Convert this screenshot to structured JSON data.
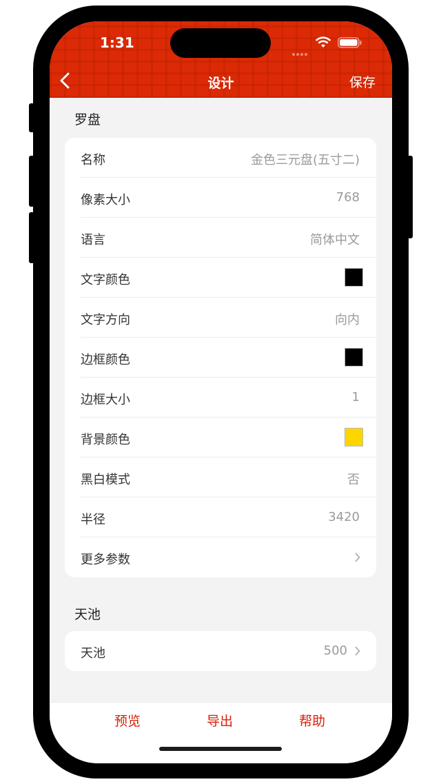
{
  "status": {
    "time": "1:31"
  },
  "nav": {
    "back_label": "<",
    "title": "设计",
    "save_label": "保存"
  },
  "sections": {
    "compass": {
      "title": "罗盘",
      "rows": [
        {
          "label": "名称",
          "value": "金色三元盘(五寸二)"
        },
        {
          "label": "像素大小",
          "value": "768"
        },
        {
          "label": "语言",
          "value": "简体中文"
        },
        {
          "label": "文字颜色",
          "color": "#000000"
        },
        {
          "label": "文字方向",
          "value": "向内"
        },
        {
          "label": "边框颜色",
          "color": "#000000"
        },
        {
          "label": "边框大小",
          "value": "1"
        },
        {
          "label": "背景颜色",
          "color": "#ffd500"
        },
        {
          "label": "黑白模式",
          "value": "否"
        },
        {
          "label": "半径",
          "value": "3420"
        },
        {
          "label": "更多参数",
          "value": ""
        }
      ]
    },
    "tianchi": {
      "title": "天池",
      "rows": [
        {
          "label": "天池",
          "value": "500"
        }
      ]
    }
  },
  "tabs": {
    "preview": "预览",
    "export": "导出",
    "help": "帮助"
  },
  "colors": {
    "accent": "#db2a05",
    "tab_text": "#d81e06"
  },
  "icons": [
    "chevron-left-icon",
    "chevron-right-icon",
    "wifi-icon",
    "battery-icon"
  ]
}
